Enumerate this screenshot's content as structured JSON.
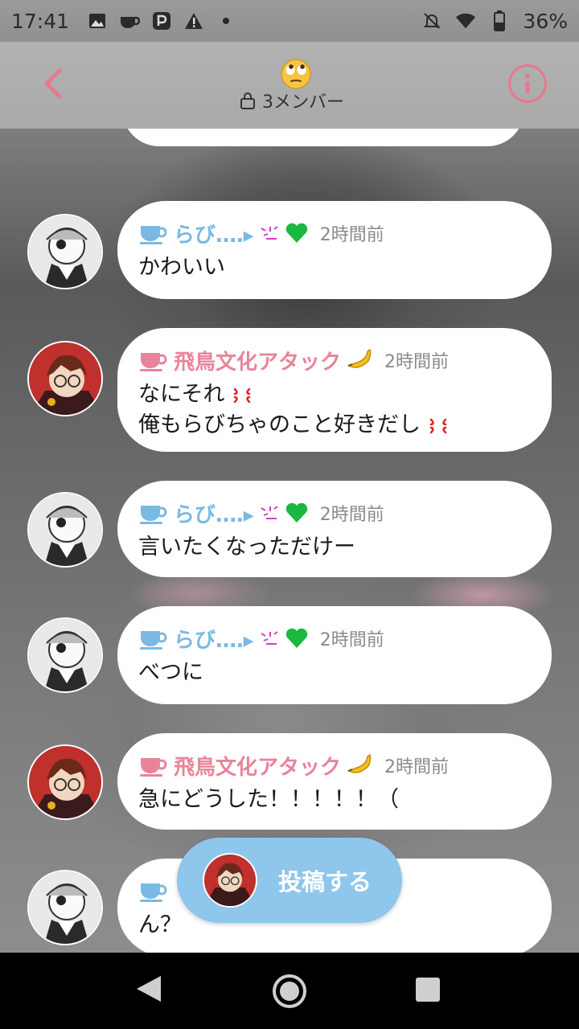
{
  "status_bar": {
    "time": "17:41",
    "battery": "36%"
  },
  "header": {
    "title_emoji": "rolling-eyes-emoji",
    "member_count": "3メンバー"
  },
  "messages": [
    {
      "sender": "らび‥‥▸",
      "name_color": "blue",
      "time": "2時間前",
      "avatar": "avatar-maid",
      "lines": [
        "かわいい"
      ]
    },
    {
      "sender": "飛鳥文化アタック",
      "name_color": "pink",
      "time": "2時間前",
      "avatar": "avatar-glasses",
      "lines": [
        "なにそれ",
        "俺もらびちゃのこと好きだし"
      ]
    },
    {
      "sender": "らび‥‥▸",
      "name_color": "blue",
      "time": "2時間前",
      "avatar": "avatar-maid",
      "lines": [
        "言いたくなっただけー"
      ]
    },
    {
      "sender": "らび‥‥▸",
      "name_color": "blue",
      "time": "2時間前",
      "avatar": "avatar-maid",
      "lines": [
        "べつに"
      ]
    },
    {
      "sender": "飛鳥文化アタック",
      "name_color": "pink",
      "time": "2時間前",
      "avatar": "avatar-glasses",
      "lines": [
        "急にどうした！！！！！（"
      ]
    },
    {
      "sender": "",
      "name_color": "blue",
      "time": "",
      "avatar": "avatar-maid",
      "lines": [
        "ん？"
      ]
    }
  ],
  "post_button": {
    "label": "投稿する"
  },
  "colors": {
    "accent_pink": "#e8788e",
    "accent_blue": "#7ab9e3",
    "post_button": "#8ec6ec"
  }
}
